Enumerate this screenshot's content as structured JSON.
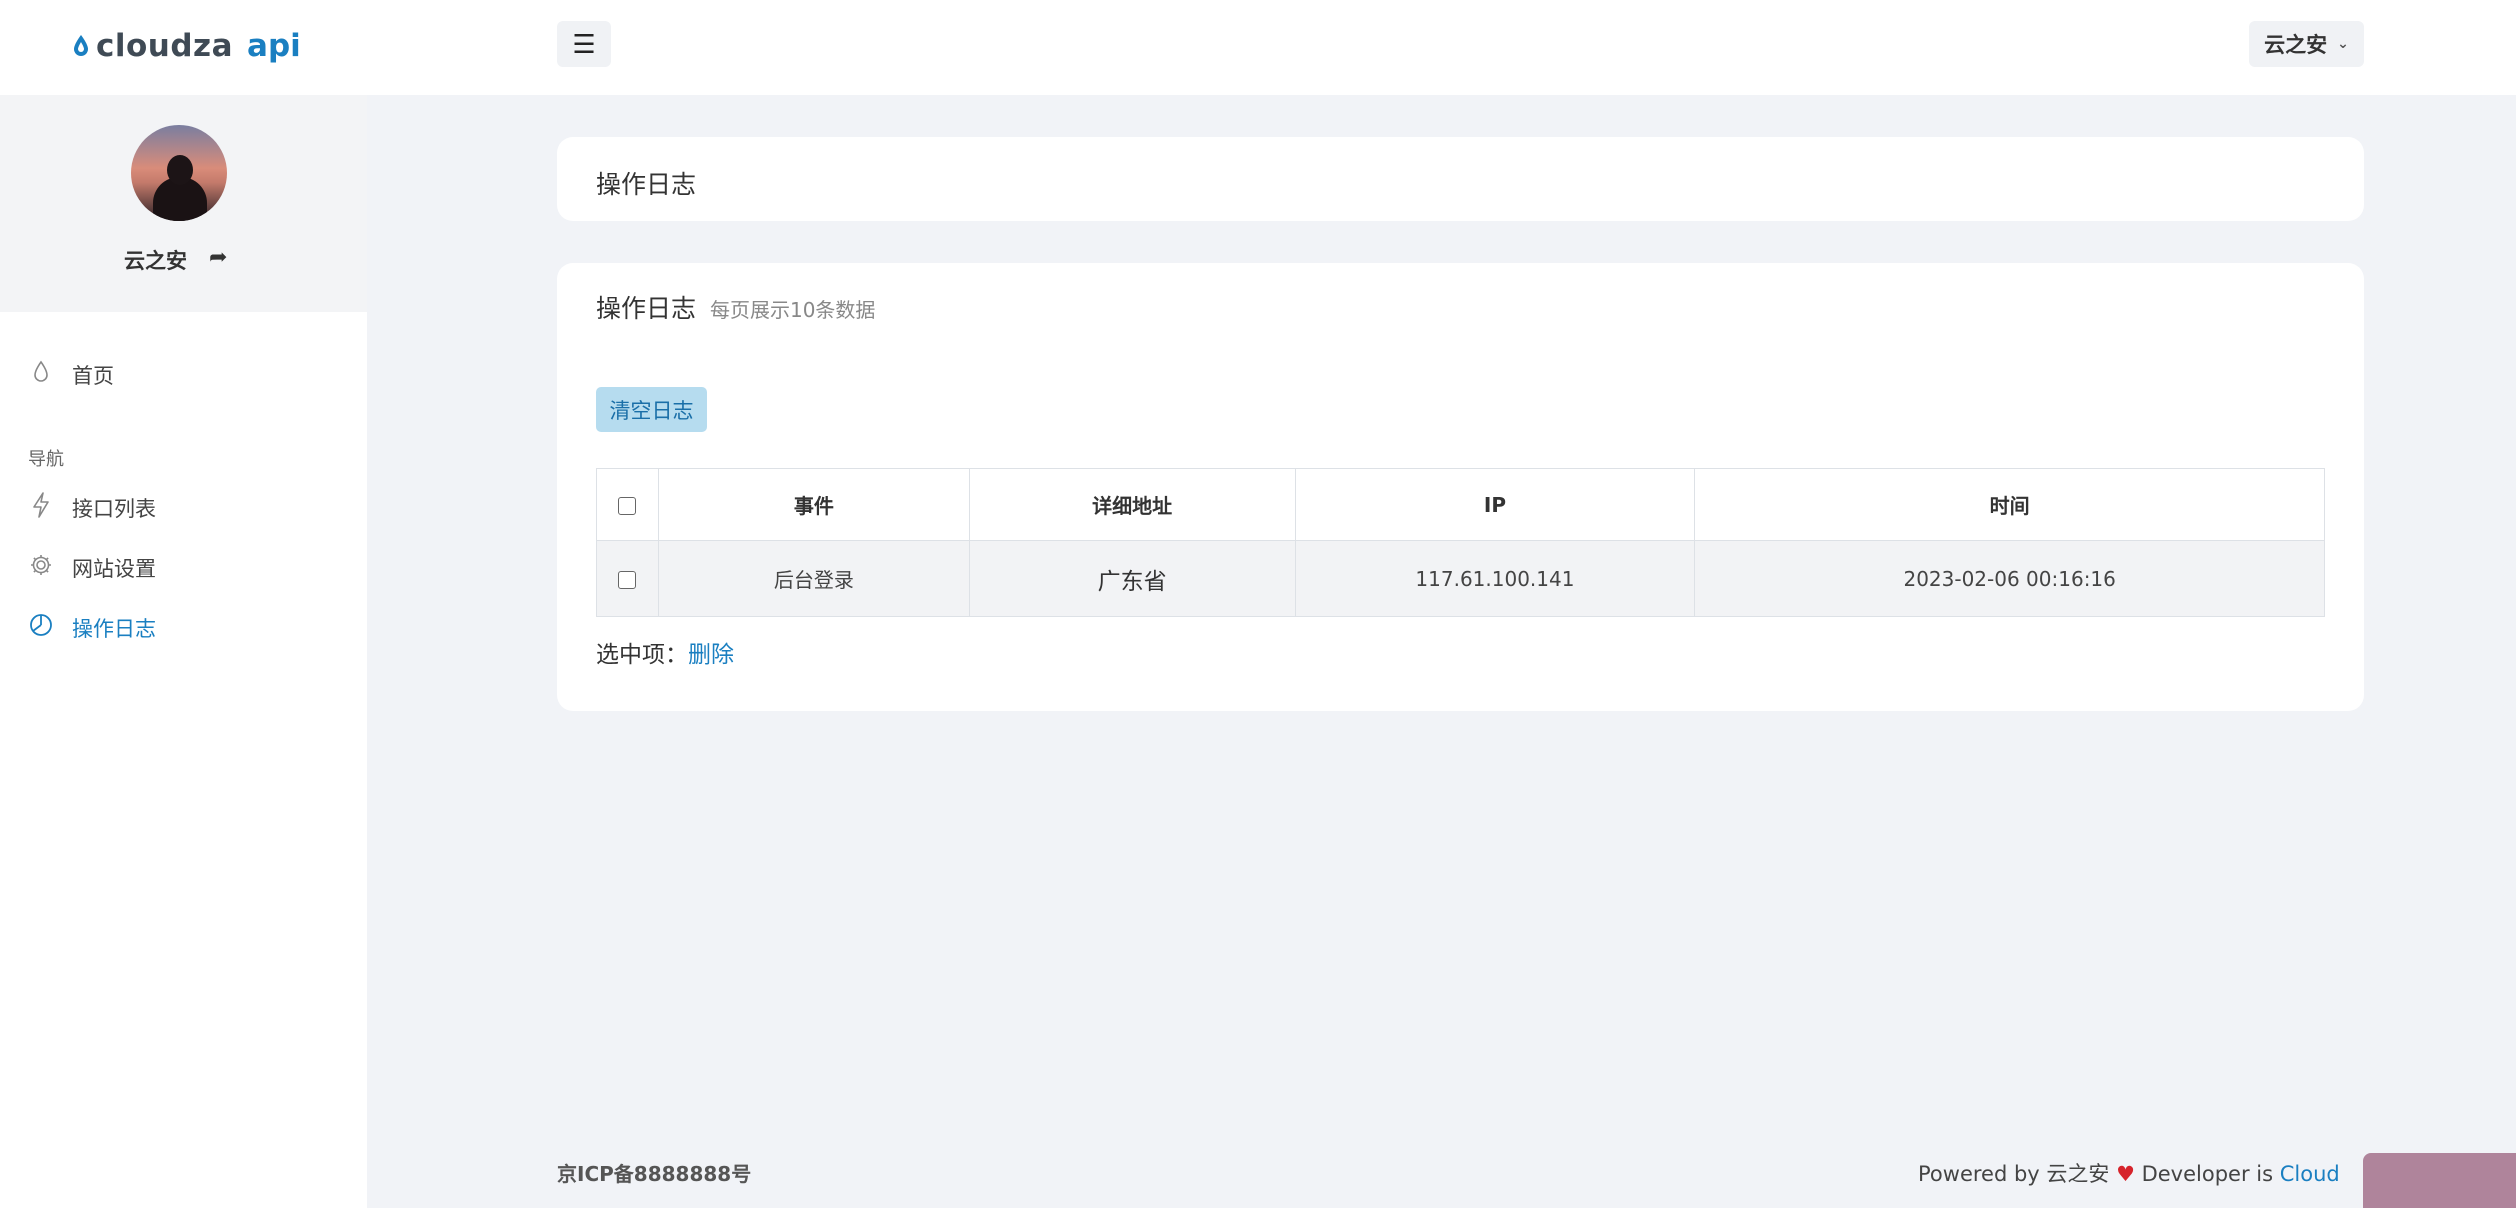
{
  "brand": {
    "name_part1": "cloudza",
    "name_part2": "api"
  },
  "topbar": {
    "menu_icon": "☰",
    "user_label": "云之安"
  },
  "profile": {
    "name": "云之安"
  },
  "sidebar": {
    "home": "首页",
    "section_label": "导航",
    "items": [
      {
        "label": "接口列表",
        "icon": "bolt-icon"
      },
      {
        "label": "网站设置",
        "icon": "gear-icon"
      },
      {
        "label": "操作日志",
        "icon": "pie-icon"
      }
    ]
  },
  "page": {
    "title": "操作日志"
  },
  "logs": {
    "title": "操作日志",
    "subtitle": "每页展示10条数据",
    "clear_button": "清空日志",
    "columns": [
      "事件",
      "详细地址",
      "IP",
      "时间"
    ],
    "rows": [
      {
        "event": "后台登录",
        "address": "广东省",
        "ip": "117.61.100.141",
        "time": "2023-02-06 00:16:16"
      }
    ],
    "selected_label": "选中项：",
    "delete_label": "删除"
  },
  "footer": {
    "icp": "京ICP备8888888号",
    "powered_prefix": "Powered by 云之安",
    "developer_prefix": "Developer is ",
    "developer_name": "Cloud"
  },
  "colors": {
    "accent": "#1a7fc1",
    "background": "#f1f3f7",
    "button_bg": "#b6dcef"
  }
}
